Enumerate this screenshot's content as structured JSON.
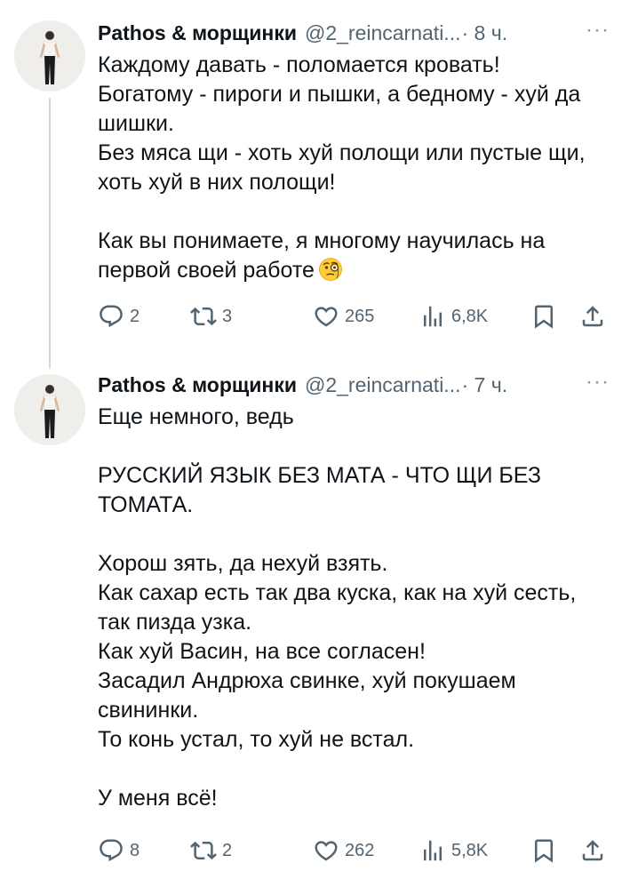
{
  "tweets": [
    {
      "author_name": "Pathos & морщинки",
      "handle": "@2_reincarnati...",
      "time": "· 8 ч.",
      "more_icon": "···",
      "text": "Каждому давать - поломается кровать!\nБогатому - пироги и пышки, а бедному - хуй да шишки.\nБез мяса щи - хоть хуй полощи или пустые щи, хоть хуй в них полощи!\n\nКак вы понимаете, я многому научилась на первой своей работе",
      "emoji": "face-with-monocle",
      "stats": {
        "replies": "2",
        "retweets": "3",
        "likes": "265",
        "views": "6,8K"
      }
    },
    {
      "author_name": "Pathos & морщинки",
      "handle": "@2_reincarnati...",
      "time": "· 7 ч.",
      "more_icon": "···",
      "text": "Еще немного, ведь\n\nРУССКИЙ ЯЗЫК БЕЗ МАТА - ЧТО ЩИ БЕЗ ТОМАТА.\n\nХорош зять, да нехуй взять.\nКак сахар есть так два куска, как на хуй сесть, так пизда узка.\nКак хуй Васин, на все согласен!\nЗасадил Андрюха свинке, хуй покушаем свининки.\nТо конь устал, то хуй не встал.\n\nУ меня всё!",
      "stats": {
        "replies": "8",
        "retweets": "2",
        "likes": "262",
        "views": "5,8K"
      }
    }
  ],
  "colors": {
    "text_primary": "#0f1419",
    "text_secondary": "#536471",
    "thread_line": "#cfd9de",
    "emoji_yellow": "#ffcc33"
  },
  "icons": [
    "reply-icon",
    "retweet-icon",
    "like-icon",
    "views-icon",
    "bookmark-icon",
    "share-icon",
    "more-icon"
  ]
}
